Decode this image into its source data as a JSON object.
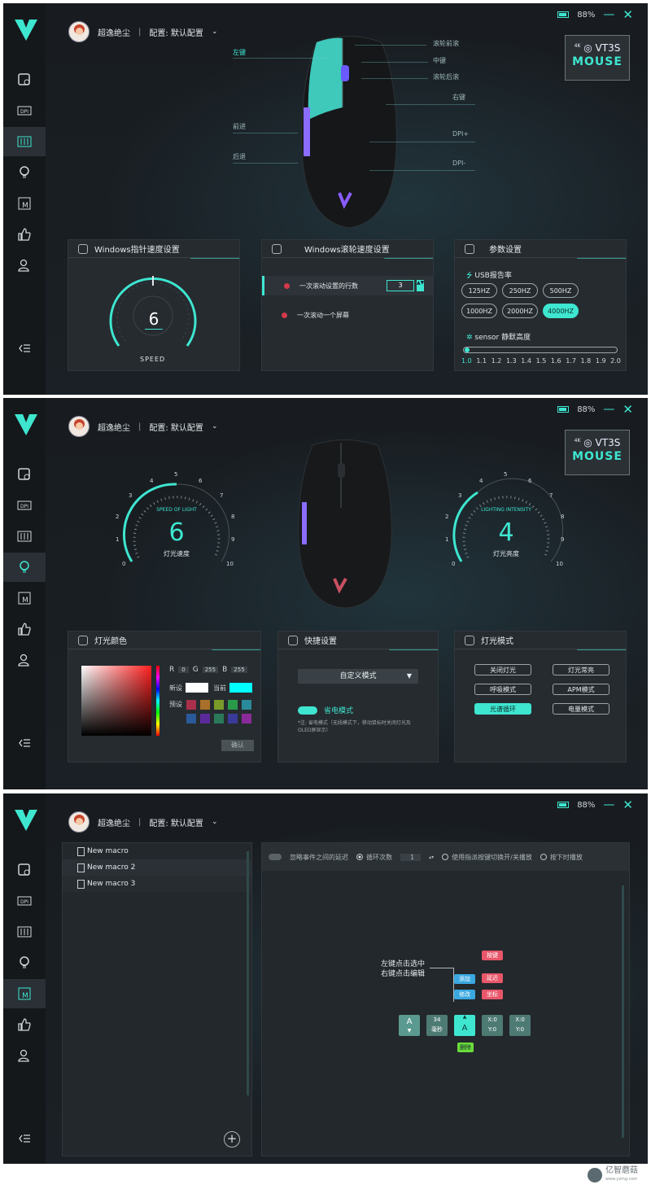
{
  "battery": "88%",
  "user": {
    "name": "超逸绝尘",
    "config_label": "配置: 默认配置"
  },
  "brand": {
    "badge": "4K",
    "line1": "VT3S",
    "line2": "MOUSE"
  },
  "colors": {
    "accent": "#3ee6d0",
    "bg": "#1c2024",
    "panel": "#262b30",
    "danger": "#d43a4a"
  },
  "sidebar_icons": [
    "performance-icon",
    "dpi-icon",
    "equalizer-icon",
    "bulb-icon",
    "macro-icon",
    "thumbs-up-icon",
    "user-settings-icon",
    "collapse-icon"
  ],
  "s1": {
    "labels": {
      "left_key": "左键",
      "forward": "前进",
      "back": "后退",
      "wheel_fwd": "滚轮前滚",
      "middle": "中键",
      "wheel_back": "滚轮后滚",
      "right_key": "右键",
      "dpi_plus": "DPI+",
      "dpi_minus": "DPI-"
    },
    "pointer": {
      "title": "Windows指针速度设置",
      "value": "6",
      "caption": "SPEED"
    },
    "scroll": {
      "title": "Windows滚轮速度设置",
      "row1": "一次滚动设置的行数",
      "row1_value": "3",
      "row2": "一次滚动一个屏幕"
    },
    "params": {
      "title": "参数设置",
      "usb_label": "USB报告率",
      "rates": [
        "125HZ",
        "250HZ",
        "500HZ",
        "1000HZ",
        "2000HZ",
        "4000HZ"
      ],
      "selected_rate": "4000HZ",
      "sensor_label": "sensor 静默高度",
      "ticks": [
        "1.0",
        "1.1",
        "1.2",
        "1.3",
        "1.4",
        "1.5",
        "1.6",
        "1.7",
        "1.8",
        "1.9",
        "2.0"
      ],
      "sensor_value": "1.0"
    }
  },
  "s2": {
    "speed": {
      "label": "SPEED OF LIGHT",
      "value": "6",
      "caption": "灯光速度",
      "ticks": [
        "0",
        "1",
        "2",
        "3",
        "4",
        "5",
        "6",
        "7",
        "8",
        "9",
        "10"
      ]
    },
    "intensity": {
      "label": "LIGHTING INTENSITY",
      "value": "4",
      "caption": "灯光亮度",
      "ticks": [
        "0",
        "1",
        "2",
        "3",
        "4",
        "5",
        "6",
        "7",
        "8",
        "9",
        "10"
      ]
    },
    "color": {
      "title": "灯光颜色",
      "r_label": "R",
      "r": "0",
      "g_label": "G",
      "g": "255",
      "b_label": "B",
      "b": "255",
      "new_label": "新设",
      "current_label": "当前",
      "preset_label": "预设",
      "confirm": "确认",
      "new_color": "#ffffff",
      "current_color": "#00ffff"
    },
    "quick": {
      "title": "快捷设置",
      "select": "自定义模式",
      "power_save": "省电模式",
      "note": "*注: 省电模式（无线模式下，移动鼠标时关闭灯光及OLED屏显示）"
    },
    "mode": {
      "title": "灯光模式",
      "modes": [
        "关闭灯光",
        "灯光常亮",
        "呼吸模式",
        "APM模式",
        "光谱循环",
        "电量模式"
      ],
      "selected": "光谱循环"
    }
  },
  "s3": {
    "macros": [
      "New macro",
      "New macro 2",
      "New macro 3"
    ],
    "toolbar": {
      "ignore_delay": "忽略事件之间的延迟",
      "loop_count": "循环次数",
      "loop_value": "1",
      "toggle_play": "使用指派按键切换开/关播放",
      "hold_play": "按下时播放"
    },
    "hint": {
      "line1": "左键点击选中",
      "line2": "右键点击编辑"
    },
    "menu": {
      "add": "添加",
      "modify": "修改",
      "key": "按键",
      "delay": "延迟",
      "coord": "坐标"
    },
    "keys": {
      "k1": "A",
      "delay_value": "34",
      "delay_unit": "毫秒",
      "k2": "A",
      "c1x": "X:0",
      "c1y": "Y:0",
      "c2x": "X:0",
      "c2y": "Y:0",
      "delete": "删除"
    }
  },
  "watermark": {
    "name": "亿智蘑菇",
    "url": "www.yzmg.com"
  }
}
